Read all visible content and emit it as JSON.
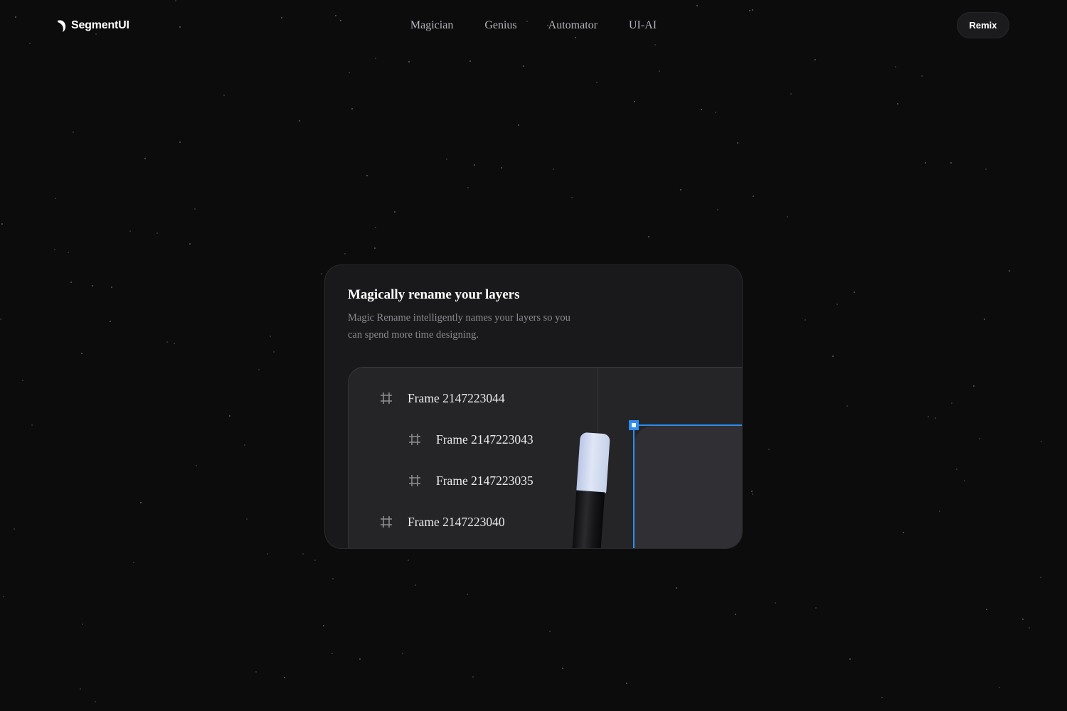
{
  "header": {
    "logo_text": "SegmentUI",
    "nav": [
      "Magician",
      "Genius",
      "Automator",
      "UI-AI"
    ],
    "remix_label": "Remix"
  },
  "card": {
    "title": "Magically rename your layers",
    "description": "Magic Rename intelligently names your layers so you can spend more time designing.",
    "layers": [
      {
        "label": "Frame 2147223044",
        "nested": false
      },
      {
        "label": "Frame 2147223043",
        "nested": true
      },
      {
        "label": "Frame 2147223035",
        "nested": true
      },
      {
        "label": "Frame 2147223040",
        "nested": false
      }
    ]
  },
  "colors": {
    "background": "#0c0c0d",
    "card": "#19191b",
    "selection": "#2f8cf0"
  }
}
